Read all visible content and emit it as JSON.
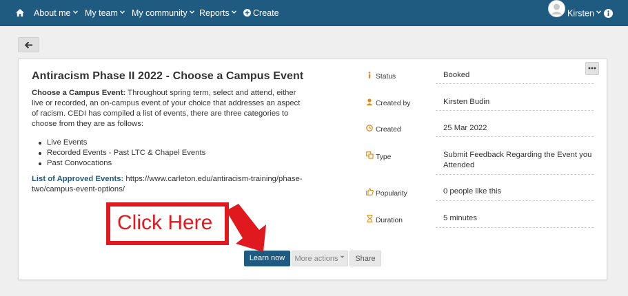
{
  "nav": {
    "about": "About me",
    "team": "My team",
    "community": "My community",
    "reports": "Reports",
    "create": "Create",
    "user": "Kirsten"
  },
  "event": {
    "title": "Antiracism Phase II 2022 - Choose a Campus Event",
    "desc_label": "Choose a Campus Event:",
    "desc_text": " Throughout spring term, select and attend, either live or recorded, an on-campus event of your choice that addresses an aspect of racism. CEDI has compiled a list of events, there are three categories to choose from they are as follows:",
    "bullets": [
      "Live Events",
      "Recorded Events - Past LTC & Chapel Events",
      "Past Convocations"
    ],
    "links_label": "List of Approved Events:",
    "links_text": " https://www.carleton.edu/antiracism-training/phase-two/campus-event-options/"
  },
  "meta": {
    "status_label": "Status",
    "status_value": "Booked",
    "created_by_label": "Created by",
    "created_by_value": "Kirsten Budin",
    "created_label": "Created",
    "created_value": "25 Mar 2022",
    "type_label": "Type",
    "type_value": "Submit Feedback Regarding the Event you Attended",
    "popularity_label": "Popularity",
    "popularity_value": "0 people like this",
    "duration_label": "Duration",
    "duration_value": "5 minutes"
  },
  "actions": {
    "learn": "Learn now",
    "more": "More actions",
    "share": "Share"
  },
  "callout": "Click Here",
  "colors": {
    "nav_bg": "#1f5a80",
    "primary": "#1f5a80",
    "callout_red": "#e0191f",
    "meta_icon": "#e08a16"
  },
  "icons": [
    "home-icon",
    "plus-circle-icon",
    "avatar",
    "info-icon",
    "arrow-left-icon",
    "ellipsis-icon",
    "info-small-icon",
    "user-icon",
    "clock-icon",
    "type-icon",
    "thumbs-up-icon",
    "hourglass-icon"
  ]
}
